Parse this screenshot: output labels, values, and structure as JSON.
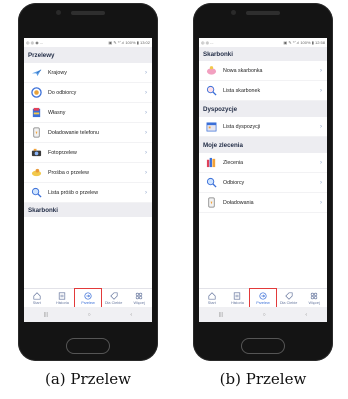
{
  "left_screen": {
    "status_left": "◎ ◎ ◉ ...",
    "status_right": "▣ ✎ ⁰ᐟ.ıl 100% ▮ 13:02",
    "section_title": "Przelewy",
    "items": [
      {
        "label": "Krajowy",
        "icon": "plane-icon"
      },
      {
        "label": "Do odbiorcy",
        "icon": "recipient-icon"
      },
      {
        "label": "Własny",
        "icon": "coins-icon"
      },
      {
        "label": "Doładowanie telefonu",
        "icon": "phone-icon"
      },
      {
        "label": "Fotoprzelew",
        "icon": "camera-icon"
      },
      {
        "label": "Prośba o przelew",
        "icon": "hand-icon"
      },
      {
        "label": "Lista próśb o przelew",
        "icon": "search-icon"
      }
    ],
    "next_section": "Skarbonki"
  },
  "right_screen": {
    "status_left": "◎ ◎ ...",
    "status_right": "▣ ✎ ⁰ᐟ.ıl 100% ▮ 12:58",
    "sections": [
      {
        "title": "Skarbonki",
        "items": [
          {
            "label": "Nowa skarbonka",
            "icon": "piggy-icon"
          },
          {
            "label": "Lista skarbonek",
            "icon": "search-icon"
          }
        ]
      },
      {
        "title": "Dyspozycje",
        "items": [
          {
            "label": "Lista dyspozycji",
            "icon": "calendar-icon"
          }
        ]
      },
      {
        "title": "Moje zlecenia",
        "items": [
          {
            "label": "Zlecenia",
            "icon": "books-icon"
          },
          {
            "label": "Odbiorcy",
            "icon": "search-icon"
          },
          {
            "label": "Doładowania",
            "icon": "phone-icon"
          }
        ]
      }
    ]
  },
  "bottom_nav": [
    "Start",
    "Historia",
    "Przelew",
    "Dla Ciebie",
    "Więcej"
  ],
  "android_nav": [
    "|||",
    "○",
    "‹"
  ],
  "captions": {
    "left": "(a) Przelew",
    "right": "(b) Przelew"
  },
  "colors": {
    "accent": "#3a6fd8",
    "highlight": "#e23a3a",
    "section_bg": "#ededf1"
  }
}
